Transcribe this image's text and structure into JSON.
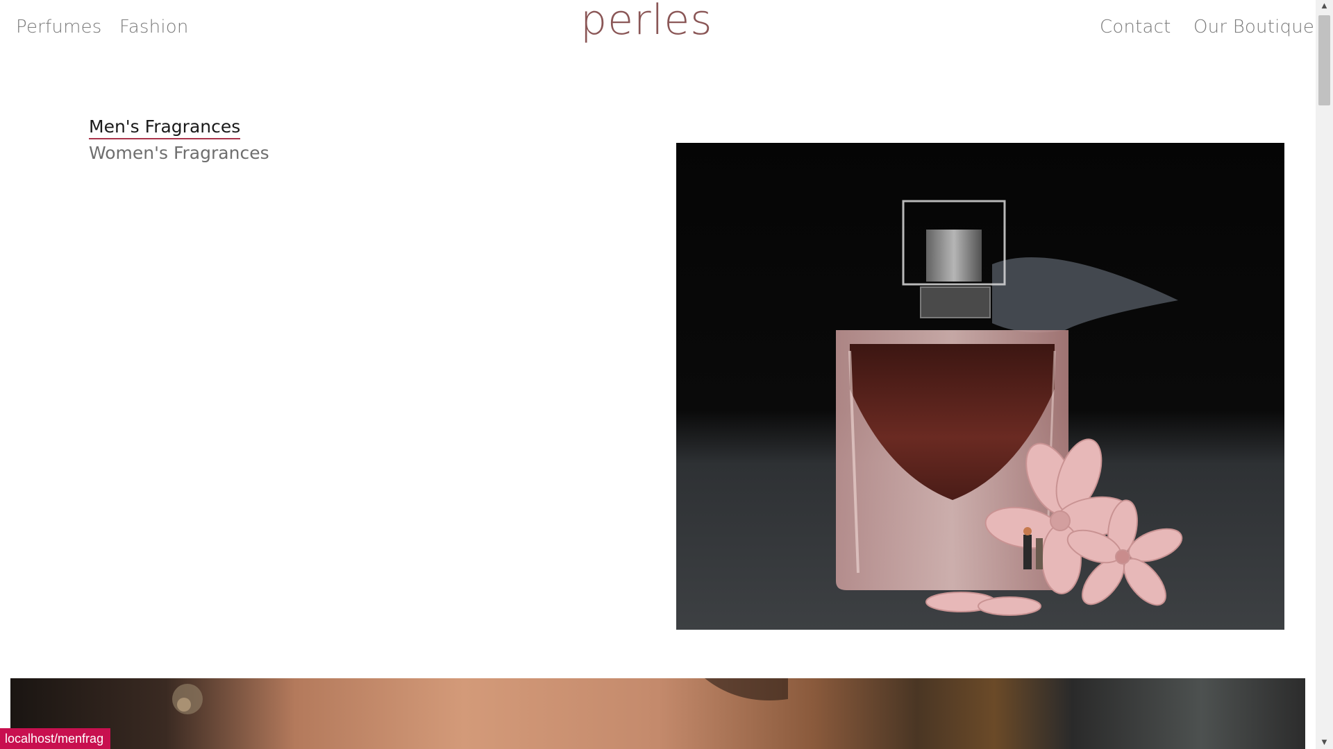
{
  "nav": {
    "left": [
      "Perfumes",
      "Fashion"
    ],
    "right": [
      "Contact",
      "Our Boutique"
    ],
    "logo": "perles"
  },
  "categories": {
    "items": [
      "Men's Fragrances",
      "Women's Fragrances"
    ],
    "active_index": 0
  },
  "hero": {
    "icon": "perfume-bottle-photo"
  },
  "status_bar": {
    "url": "localhost/menfrag"
  },
  "colors": {
    "logo": "#8a5656",
    "active_underline": "#a8334a",
    "status_bg": "#c8104f"
  }
}
